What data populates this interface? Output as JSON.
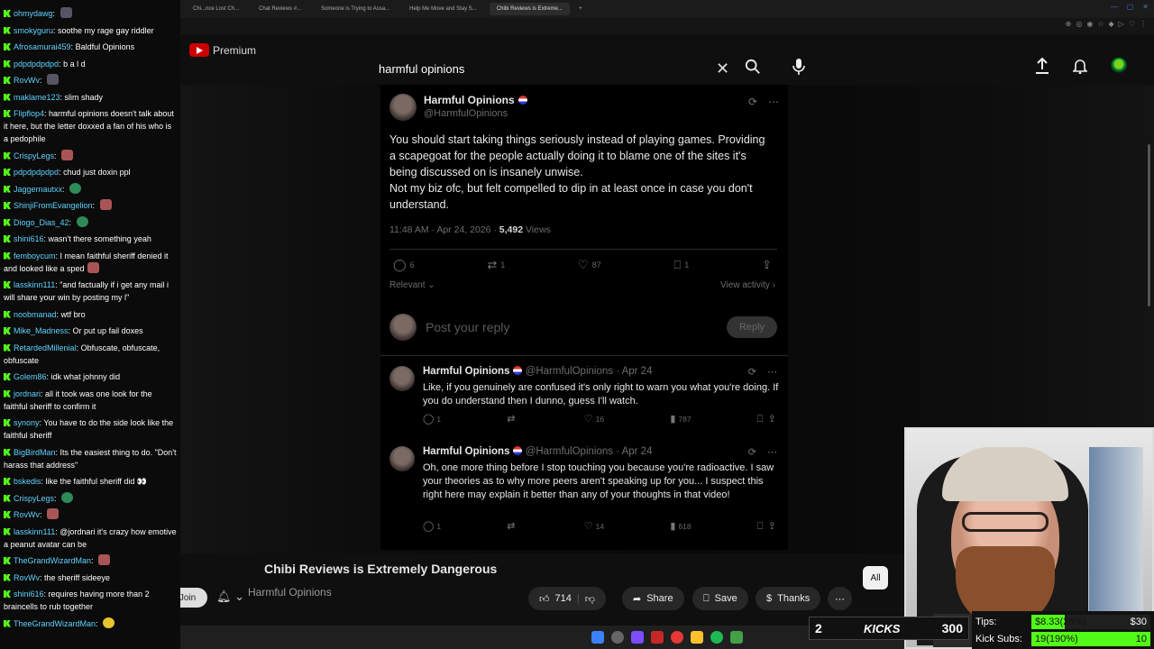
{
  "browser": {
    "tabs": [
      {
        "label": "Chi...nce Lost Ch...",
        "active": false
      },
      {
        "label": "Chat Reviews #...",
        "active": false
      },
      {
        "label": "Someone is Trying to Assa...",
        "active": false
      },
      {
        "label": "Help Me Move and Stay S...",
        "active": false
      },
      {
        "label": "Chibi Reviews is Extreme...",
        "active": true
      }
    ]
  },
  "youtube": {
    "logo_text": "Premium",
    "search_value": "harmful opinions",
    "video_title": "Chibi Reviews is Extremely Dangerous",
    "channel_name": "Harmful Opinions",
    "join_label": "Join",
    "like_count": "714",
    "share_label": "Share",
    "save_label": "Save",
    "thanks_label": "Thanks",
    "chip_all": "All"
  },
  "tweet": {
    "name": "Harmful Opinions",
    "handle": "@HarmfulOpinions",
    "body_1": "You should start taking things seriously instead of playing games. Providing a scapegoat for the people actually doing it to blame one of the sites it's being discussed on is insanely unwise.",
    "body_2": "Not my biz ofc, but felt compelled to dip in at least once in case you don't understand.",
    "time": "11:48 AM · Apr 24, 2026 · ",
    "views_count": "5,492",
    "views_label": " Views",
    "replies": "6",
    "retweets": "1",
    "likes": "87",
    "bookmarks": "1",
    "sort_label": "Relevant",
    "view_activity": "View activity",
    "reply_placeholder": "Post your reply",
    "reply_button": "Reply"
  },
  "replies": [
    {
      "name": "Harmful Opinions",
      "meta": "@HarmfulOpinions · Apr 24",
      "body": "Like, if you genuinely are confused it's only right to warn you what you're doing. If you do understand then I dunno, guess I'll watch.",
      "replies": "1",
      "likes": "16",
      "views": "787"
    },
    {
      "name": "Harmful Opinions",
      "meta": "@HarmfulOpinions · Apr 24",
      "body": "Oh, one more thing before I stop touching you because you're radioactive. I saw your theories as to why more peers aren't speaking up for you... I suspect this right here may explain it better than any of your thoughts in that video!",
      "replies": "1",
      "likes": "14",
      "views": "618"
    }
  ],
  "chat": [
    {
      "user": "ohmydawg",
      "text": "",
      "emote": "b"
    },
    {
      "user": "smokyguru",
      "text": "soothe my rage gay riddler",
      "emote": ""
    },
    {
      "user": "Afrosamurai459",
      "text": "Baldful Opinions",
      "emote": ""
    },
    {
      "user": "pdpdpdpdpd",
      "text": "b a l d",
      "emote": ""
    },
    {
      "user": "RovWv",
      "text": "",
      "emote": "b"
    },
    {
      "user": "maklame123",
      "text": "slim shady",
      "emote": ""
    },
    {
      "user": "Flipflop4",
      "text": "harmful opinions doesn't talk about it here, but the letter doxxed a fan of his who is a pedophile",
      "emote": ""
    },
    {
      "user": "CrispyLegs",
      "text": "",
      "emote": "r"
    },
    {
      "user": "pdpdpdpdpd",
      "text": "chud just doxin ppl",
      "emote": ""
    },
    {
      "user": "Jaggernautxx",
      "text": "",
      "emote": "g"
    },
    {
      "user": "ShinjiFromEvangelion",
      "text": "",
      "emote": "r"
    },
    {
      "user": "Diogo_Dias_42",
      "text": "",
      "emote": "g"
    },
    {
      "user": "shini616",
      "text": "wasn't there something yeah",
      "emote": ""
    },
    {
      "user": "femboycum",
      "text": "I mean faithful sheriff denied it and looked like a sped",
      "emote": "r"
    },
    {
      "user": "lasskinn111",
      "text": "\"and factually if i get any mail i will share your win by posting my l\"",
      "emote": ""
    },
    {
      "user": "noobmanad",
      "text": "wtf bro",
      "emote": ""
    },
    {
      "user": "Mike_Madness",
      "text": "Or put up fail doxes",
      "emote": ""
    },
    {
      "user": "RetardedMillenial",
      "text": "Obfuscate, obfuscate, obfuscate",
      "emote": ""
    },
    {
      "user": "Golem86",
      "text": "idk what johnny did",
      "emote": ""
    },
    {
      "user": "jordnari",
      "text": "all it took was one look for the faithful sheriff to confirm it",
      "emote": ""
    },
    {
      "user": "synony",
      "text": "You have to do the side look like the faithful sheriff",
      "emote": ""
    },
    {
      "user": "BigBirdMan",
      "text": "Its the easiest thing to do. \"Don't harass that address\"",
      "emote": ""
    },
    {
      "user": "bskedis",
      "text": "like the faithful sheriff did 👀",
      "emote": ""
    },
    {
      "user": "CrispyLegs",
      "text": "",
      "emote": "g"
    },
    {
      "user": "RovWv",
      "text": "",
      "emote": "r"
    },
    {
      "user": "lasskinn111",
      "text": "@jordnari it's crazy how emotive a peanut avatar can be",
      "emote": ""
    },
    {
      "user": "TheGrandWizardMan",
      "text": "",
      "emote": "r"
    },
    {
      "user": "RovWv",
      "text": "the sheriff sideeye",
      "emote": ""
    },
    {
      "user": "shini616",
      "text": "requires having more than 2 braincells to rub together",
      "emote": ""
    },
    {
      "user": "TheeGrandWizardMan",
      "text": "",
      "emote": "y"
    }
  ],
  "stream": {
    "kicks_left": "2",
    "kicks_label": "KICKS",
    "kicks_right": "300",
    "tips_label": "Tips:",
    "tips_value": "$8.33(28%)",
    "tips_goal": "$30",
    "subs_label": "Kick Subs:",
    "subs_value": "19(190%)",
    "subs_goal": "10",
    "tips_fraction": 0.28,
    "subs_fraction": 1.0
  },
  "colors": {
    "kick_green": "#53fc18",
    "chat_user": "#5fd3ff",
    "youtube_red": "#cc0000"
  }
}
